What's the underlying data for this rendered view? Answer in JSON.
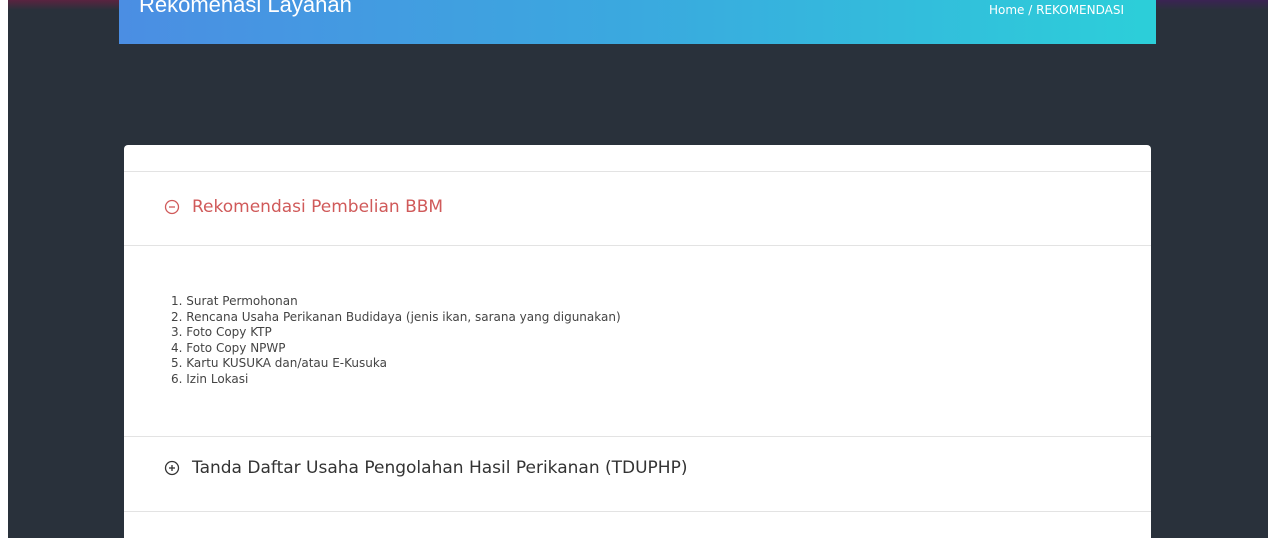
{
  "header": {
    "title": "Rekomenasi Layanan",
    "breadcrumb": {
      "home": "Home",
      "separator": "/",
      "current": "REKOMENDASI"
    }
  },
  "accordion": {
    "items": [
      {
        "title": "Rekomendasi Pembelian BBM",
        "icon": "minus-circle-icon",
        "expanded": true,
        "requirements": [
          "1. Surat Permohonan",
          "2. Rencana Usaha Perikanan Budidaya (jenis ikan, sarana yang digunakan)",
          "3. Foto Copy KTP",
          "4. Foto Copy NPWP",
          "5. Kartu KUSUKA dan/atau E-Kusuka",
          "6. Izin Lokasi"
        ]
      },
      {
        "title": "Tanda Daftar Usaha Pengolahan Hasil Perikanan (TDUPHP)",
        "icon": "plus-circle-icon",
        "expanded": false
      }
    ]
  },
  "colors": {
    "page_background": "#29313b",
    "banner_gradient_start": "#4b8ee3",
    "banner_gradient_end": "#2ccfd9",
    "active_title": "#d05a5a",
    "inactive_title": "#333333"
  }
}
